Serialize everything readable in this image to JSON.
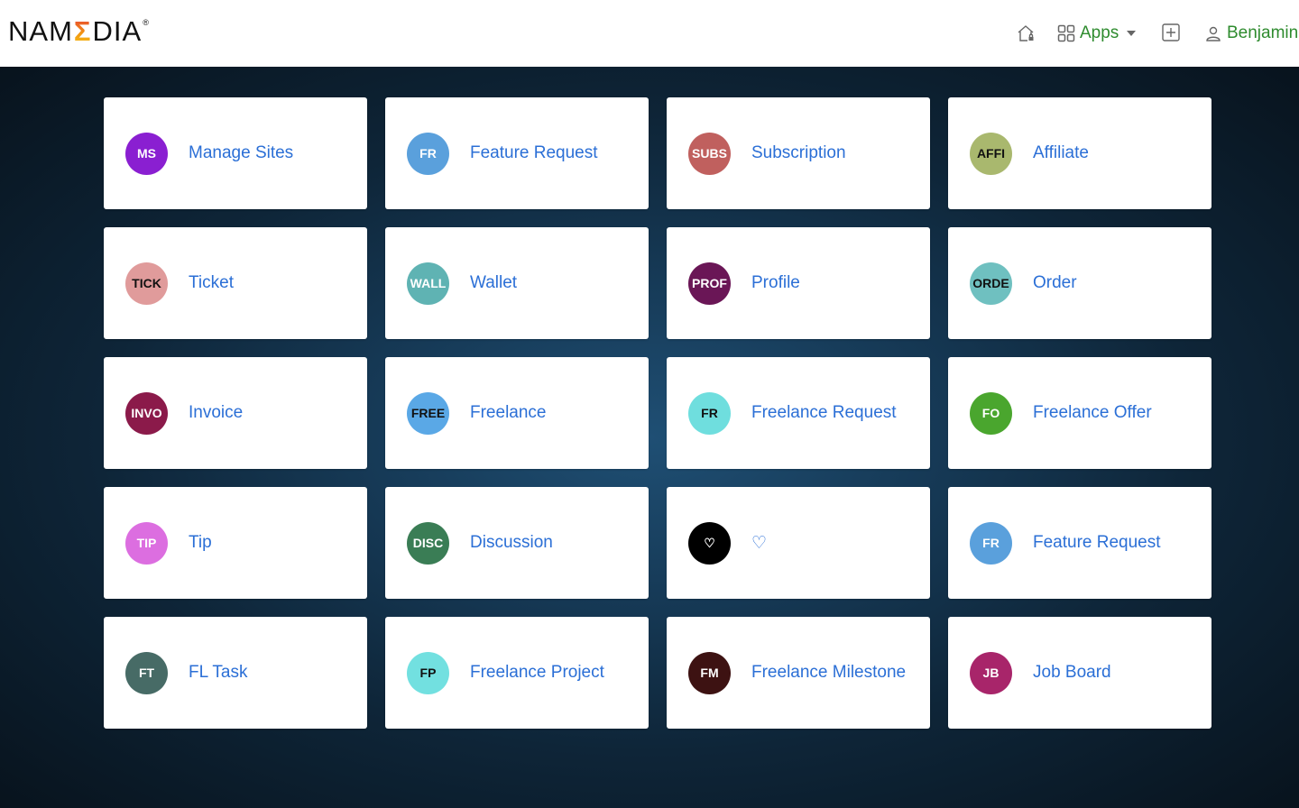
{
  "header": {
    "logo_left": "NAM",
    "logo_sigma": "Σ",
    "logo_right": "DIA",
    "logo_reg": "®",
    "apps_label": "Apps",
    "user_label": "Benjamin"
  },
  "icons": {
    "home": "home-icon",
    "apps": "grid-icon",
    "add": "plus-square-icon",
    "user": "user-icon"
  },
  "apps": [
    {
      "abbr": "MS",
      "label": "Manage Sites",
      "color": "#8a1fd1",
      "text_color": "#ffffff"
    },
    {
      "abbr": "FR",
      "label": "Feature Request",
      "color": "#5aa0dc",
      "text_color": "#ffffff"
    },
    {
      "abbr": "SUBS",
      "label": "Subscription",
      "color": "#c0605e",
      "text_color": "#ffffff"
    },
    {
      "abbr": "AFFI",
      "label": "Affiliate",
      "color": "#a9b86e",
      "text_color": "#111111"
    },
    {
      "abbr": "TICK",
      "label": "Ticket",
      "color": "#e09b9b",
      "text_color": "#111111"
    },
    {
      "abbr": "WALL",
      "label": "Wallet",
      "color": "#5fb3b3",
      "text_color": "#ffffff"
    },
    {
      "abbr": "PROF",
      "label": "Profile",
      "color": "#6a1656",
      "text_color": "#ffffff"
    },
    {
      "abbr": "ORDE",
      "label": "Order",
      "color": "#6fc0c0",
      "text_color": "#111111"
    },
    {
      "abbr": "INVO",
      "label": "Invoice",
      "color": "#8b1a4a",
      "text_color": "#ffffff"
    },
    {
      "abbr": "FREE",
      "label": "Freelance",
      "color": "#5aa8e6",
      "text_color": "#111111"
    },
    {
      "abbr": "FR",
      "label": "Freelance Request",
      "color": "#6fdede",
      "text_color": "#111111"
    },
    {
      "abbr": "FO",
      "label": "Freelance Offer",
      "color": "#4aa62e",
      "text_color": "#ffffff"
    },
    {
      "abbr": "TIP",
      "label": "Tip",
      "color": "#dc6ee0",
      "text_color": "#ffffff"
    },
    {
      "abbr": "DISC",
      "label": "Discussion",
      "color": "#3a7d55",
      "text_color": "#ffffff"
    },
    {
      "abbr": "♡",
      "label": "♡",
      "color": "#000000",
      "text_color": "#ffffff"
    },
    {
      "abbr": "FR",
      "label": "Feature Request",
      "color": "#5aa0dc",
      "text_color": "#ffffff"
    },
    {
      "abbr": "FT",
      "label": "FL Task",
      "color": "#476b66",
      "text_color": "#ffffff"
    },
    {
      "abbr": "FP",
      "label": "Freelance Project",
      "color": "#72e0e0",
      "text_color": "#111111"
    },
    {
      "abbr": "FM",
      "label": "Freelance Milestone",
      "color": "#3d1212",
      "text_color": "#ffffff"
    },
    {
      "abbr": "JB",
      "label": "Job Board",
      "color": "#a8256a",
      "text_color": "#ffffff"
    }
  ]
}
